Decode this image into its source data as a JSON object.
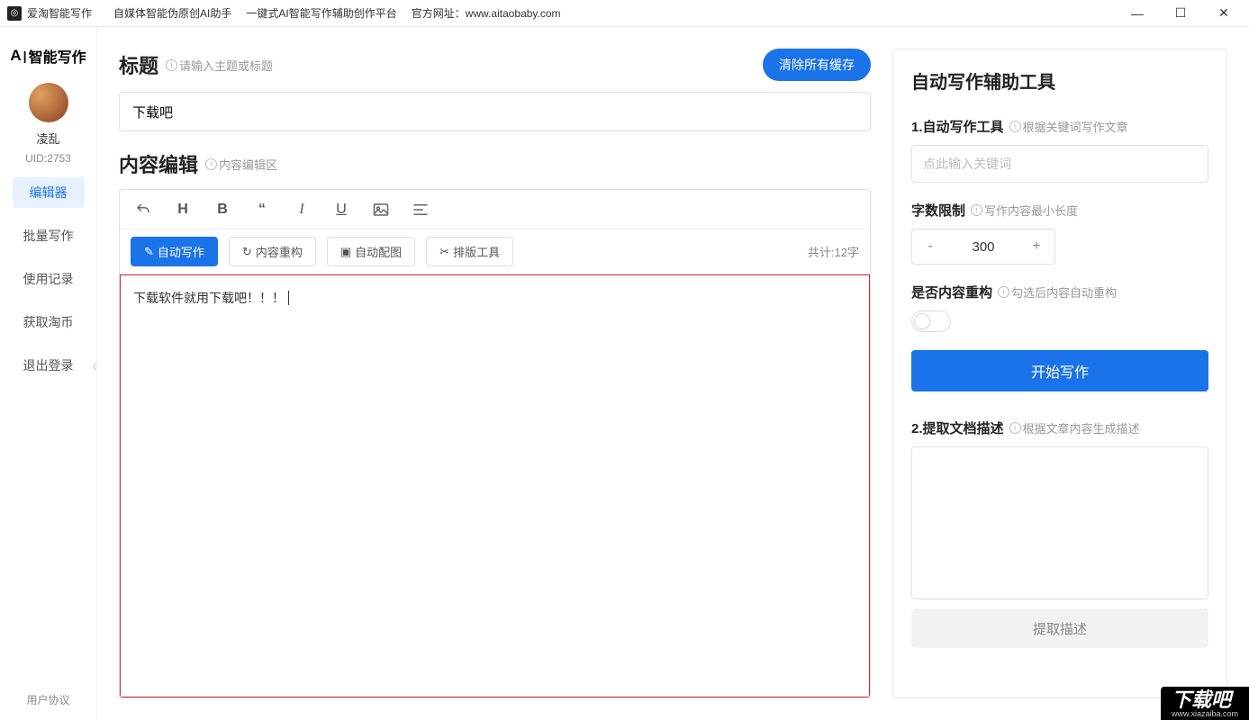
{
  "titlebar": {
    "app_name": "爱淘智能写作",
    "tagline1": "自媒体智能伪原创AI助手",
    "tagline2": "一键式AI智能写作辅助创作平台",
    "site_label": "官方网址：",
    "site_url": "www.aitaobaby.com"
  },
  "sidebar": {
    "logo_text": "智能写作",
    "username": "凌乱",
    "uid": "UID:2753",
    "items": [
      {
        "label": "编辑器",
        "active": true
      },
      {
        "label": "批量写作",
        "active": false
      },
      {
        "label": "使用记录",
        "active": false
      },
      {
        "label": "获取淘币",
        "active": false
      },
      {
        "label": "退出登录",
        "active": false
      }
    ],
    "footer": "用户协议"
  },
  "editor": {
    "title_label": "标题",
    "title_hint": "请输入主题或标题",
    "clear_cache": "清除所有缓存",
    "title_value": "下载吧",
    "content_label": "内容编辑",
    "content_hint": "内容编辑区",
    "actions": {
      "auto_write": "自动写作",
      "rebuild": "内容重构",
      "auto_image": "自动配图",
      "layout_tool": "排版工具"
    },
    "word_count": "共计:12字",
    "content_text": "下载软件就用下载吧！！！"
  },
  "panel": {
    "title": "自动写作辅助工具",
    "s1_title": "1.自动写作工具",
    "s1_hint": "根据关键词写作文章",
    "keyword_placeholder": "点此输入关键词",
    "limit_title": "字数限制",
    "limit_hint": "写作内容最小长度",
    "limit_value": "300",
    "rebuild_title": "是否内容重构",
    "rebuild_hint": "勾选后内容自动重构",
    "start_button": "开始写作",
    "s2_title": "2.提取文档描述",
    "s2_hint": "根据文章内容生成描述",
    "extract_button": "提取描述"
  },
  "watermark": {
    "main": "下载吧",
    "sub": "www.xiazaiba.com"
  }
}
